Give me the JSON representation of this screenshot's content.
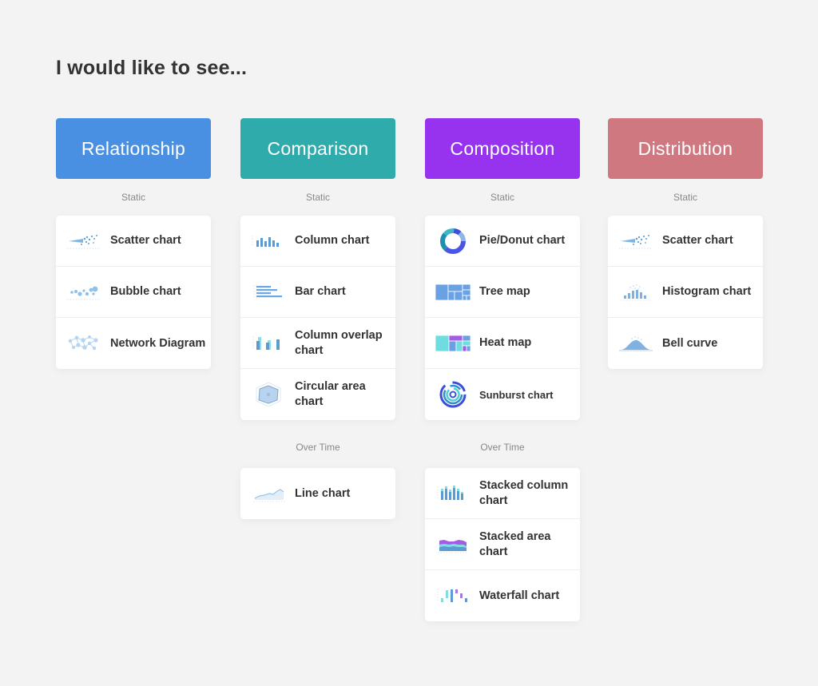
{
  "page": {
    "title": "I would like to see..."
  },
  "categories": [
    {
      "name": "Relationship",
      "color": "#4a90e2",
      "sections": [
        {
          "label": "Static",
          "items": [
            {
              "label": "Scatter chart",
              "icon": "scatter-chart-icon"
            },
            {
              "label": "Bubble chart",
              "icon": "bubble-chart-icon"
            },
            {
              "label": "Network Diagram",
              "icon": "network-diagram-icon"
            }
          ]
        }
      ]
    },
    {
      "name": "Comparison",
      "color": "#2fabab",
      "sections": [
        {
          "label": "Static",
          "items": [
            {
              "label": "Column chart",
              "icon": "column-chart-icon"
            },
            {
              "label": "Bar chart",
              "icon": "bar-chart-icon"
            },
            {
              "label": "Column overlap chart",
              "icon": "column-overlap-chart-icon"
            },
            {
              "label": "Circular area chart",
              "icon": "circular-area-chart-icon"
            }
          ]
        },
        {
          "label": "Over Time",
          "items": [
            {
              "label": "Line chart",
              "icon": "line-chart-icon"
            }
          ]
        }
      ]
    },
    {
      "name": "Composition",
      "color": "#9733ee",
      "sections": [
        {
          "label": "Static",
          "items": [
            {
              "label": "Pie/Donut chart",
              "icon": "donut-chart-icon"
            },
            {
              "label": "Tree map",
              "icon": "tree-map-icon"
            },
            {
              "label": "Heat map",
              "icon": "heat-map-icon"
            },
            {
              "label": "Sunburst chart",
              "icon": "sunburst-chart-icon"
            }
          ]
        },
        {
          "label": "Over Time",
          "items": [
            {
              "label": "Stacked column chart",
              "icon": "stacked-column-chart-icon"
            },
            {
              "label": "Stacked area chart",
              "icon": "stacked-area-chart-icon"
            },
            {
              "label": "Waterfall chart",
              "icon": "waterfall-chart-icon"
            }
          ]
        }
      ]
    },
    {
      "name": "Distribution",
      "color": "#d07880",
      "sections": [
        {
          "label": "Static",
          "items": [
            {
              "label": "Scatter chart",
              "icon": "scatter-chart-icon"
            },
            {
              "label": "Histogram chart",
              "icon": "histogram-chart-icon"
            },
            {
              "label": "Bell curve",
              "icon": "bell-curve-icon"
            }
          ]
        }
      ]
    }
  ]
}
